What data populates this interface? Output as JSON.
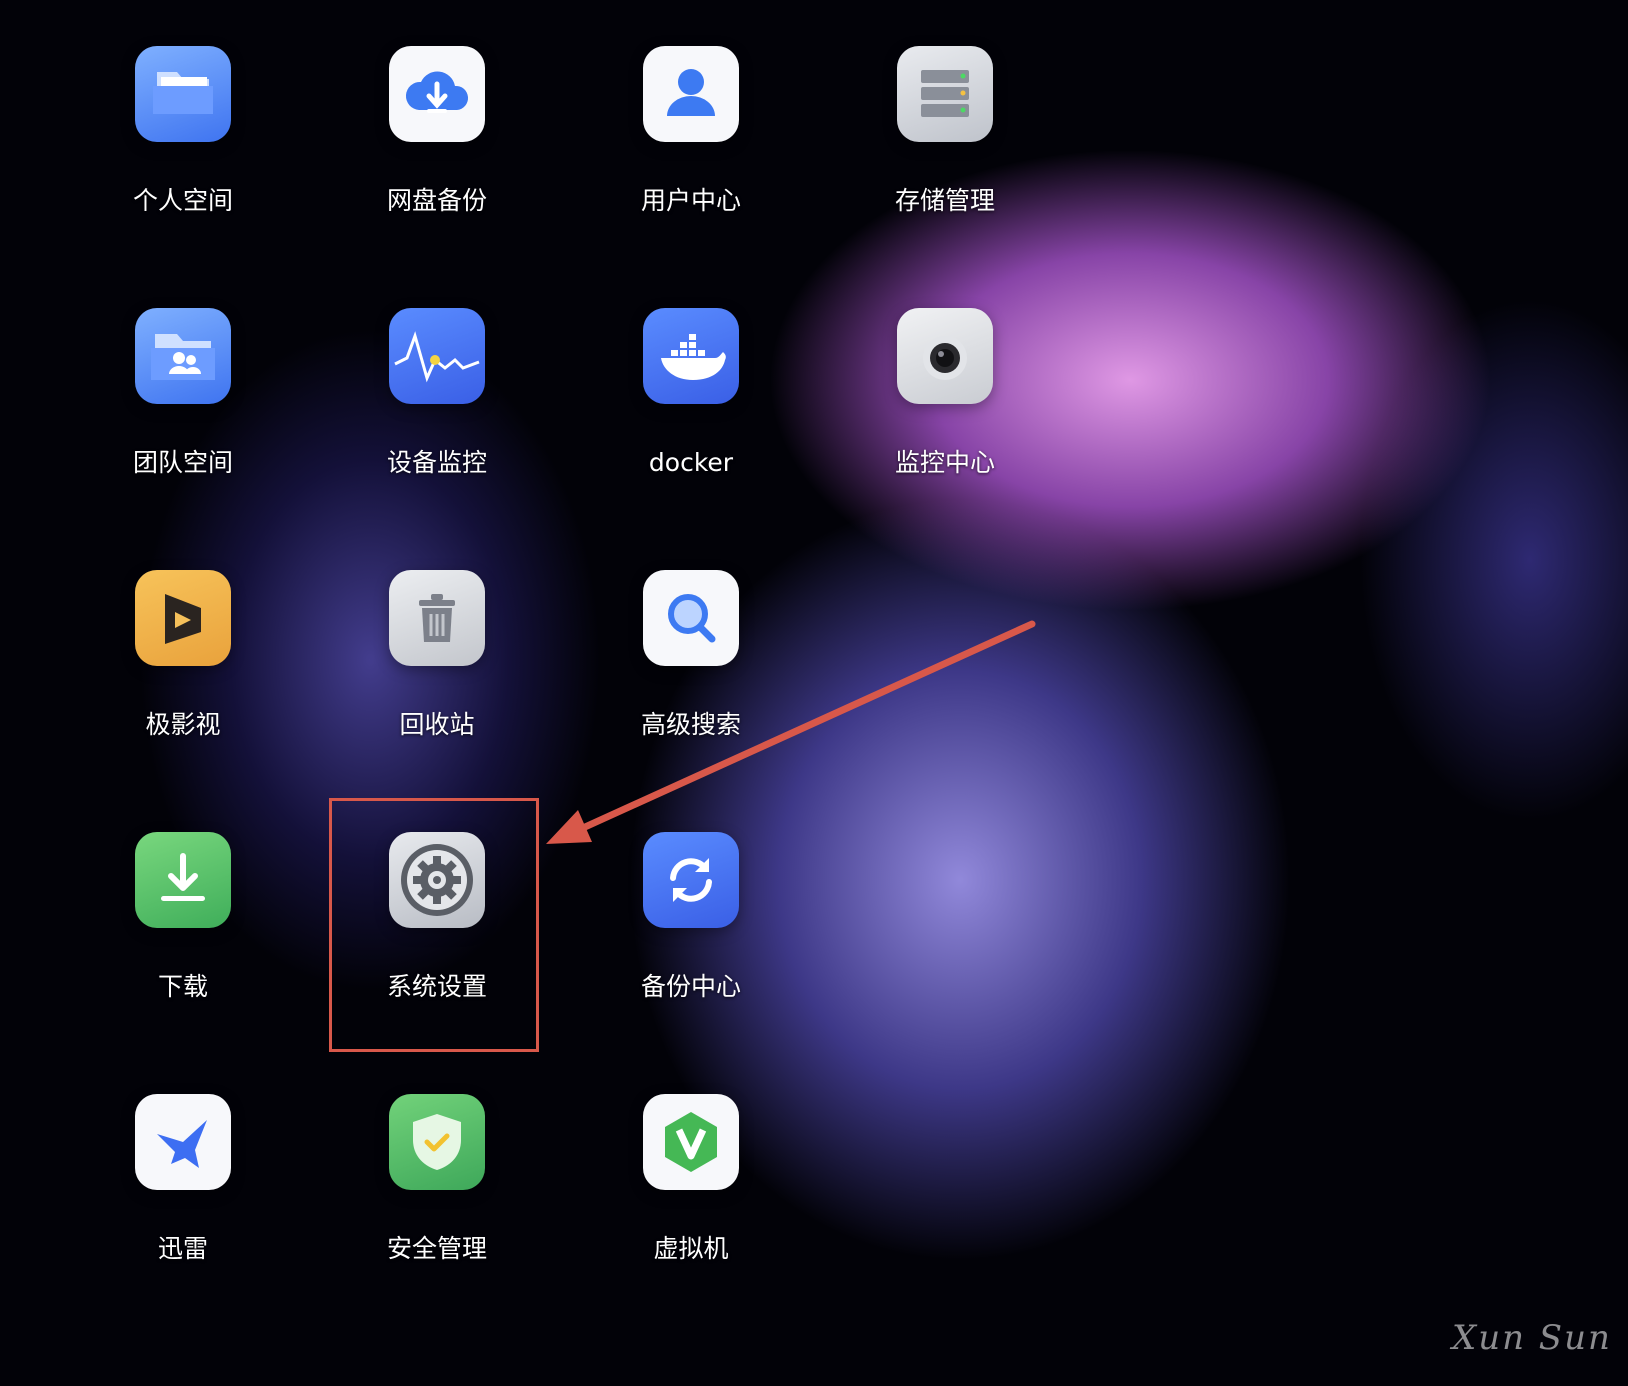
{
  "apps": {
    "personal_space": {
      "label": "个人空间",
      "icon": "folder-icon"
    },
    "cloud_backup": {
      "label": "网盘备份",
      "icon": "cloud-download-icon"
    },
    "user_center": {
      "label": "用户中心",
      "icon": "user-icon"
    },
    "storage_manager": {
      "label": "存储管理",
      "icon": "server-icon"
    },
    "team_space": {
      "label": "团队空间",
      "icon": "team-folder-icon"
    },
    "device_monitor": {
      "label": "设备监控",
      "icon": "waveform-icon"
    },
    "docker": {
      "label": "docker",
      "icon": "docker-whale-icon"
    },
    "surveillance": {
      "label": "监控中心",
      "icon": "camera-icon"
    },
    "video": {
      "label": "极影视",
      "icon": "play-film-icon"
    },
    "trash": {
      "label": "回收站",
      "icon": "trash-icon"
    },
    "search": {
      "label": "高级搜索",
      "icon": "magnifier-icon"
    },
    "download": {
      "label": "下载",
      "icon": "download-icon"
    },
    "settings": {
      "label": "系统设置",
      "icon": "gear-icon"
    },
    "backup_center": {
      "label": "备份中心",
      "icon": "sync-icon"
    },
    "xunlei": {
      "label": "迅雷",
      "icon": "bird-icon"
    },
    "security": {
      "label": "安全管理",
      "icon": "shield-check-icon"
    },
    "vm": {
      "label": "虚拟机",
      "icon": "v-hexagon-icon"
    }
  },
  "annotation": {
    "color": "#d8584a"
  },
  "signature": {
    "text": "Xun Sun"
  }
}
